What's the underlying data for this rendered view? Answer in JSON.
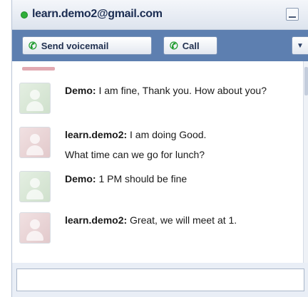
{
  "window": {
    "title": "learn.demo2@gmail.com",
    "status_color": "#2fae3a"
  },
  "toolbar": {
    "voicemail_label": "Send voicemail",
    "call_label": "Call",
    "phone_glyph": "✆",
    "dropdown_glyph": "▼"
  },
  "messages": [
    {
      "sender": "Demo:",
      "avatar": "demo",
      "lines": [
        "I am fine, Thank you. How about you?"
      ]
    },
    {
      "sender": "learn.demo2:",
      "avatar": "learn",
      "lines": [
        "I am doing Good.",
        "What time can we go for lunch?"
      ]
    },
    {
      "sender": "Demo:",
      "avatar": "demo",
      "lines": [
        "1 PM should be fine"
      ]
    },
    {
      "sender": "learn.demo2:",
      "avatar": "learn",
      "lines": [
        "Great, we will meet at 1."
      ]
    }
  ],
  "input": {
    "value": ""
  }
}
